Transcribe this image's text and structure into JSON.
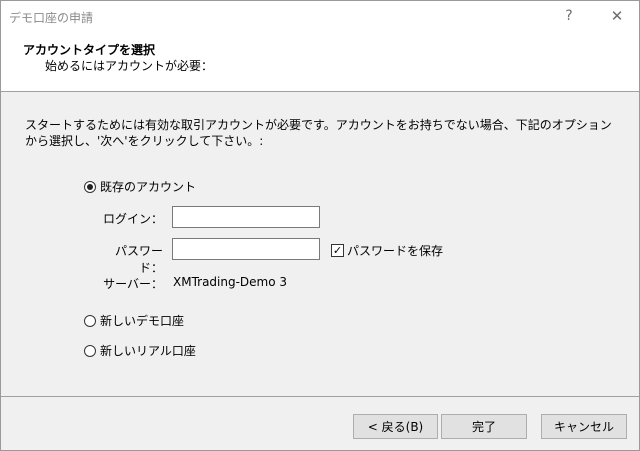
{
  "window": {
    "title": "デモ口座の申請",
    "help": "?",
    "close": "✕"
  },
  "header": {
    "title": "アカウントタイプを選択",
    "subtitle": "始めるにはアカウントが必要："
  },
  "description": "スタートするためには有効な取引アカウントが必要です。アカウントをお持ちでない場合、下記のオプションから選択し、'次へ'をクリックして下さい。:",
  "options": {
    "existing": {
      "label": "既存のアカウント",
      "checked": true
    },
    "new_demo": {
      "label": "新しいデモ口座",
      "checked": false
    },
    "new_real": {
      "label": "新しいリアル口座",
      "checked": false
    }
  },
  "form": {
    "login_label": "ログイン：",
    "login_value": "",
    "password_label": "パスワード：",
    "password_value": "",
    "save_password_label": "パスワードを保存",
    "save_password_checked": true,
    "server_label": "サーバー：",
    "server_value": "XMTrading-Demo 3"
  },
  "buttons": {
    "back": "< 戻る(B)",
    "finish": "完了",
    "cancel": "キャンセル"
  }
}
